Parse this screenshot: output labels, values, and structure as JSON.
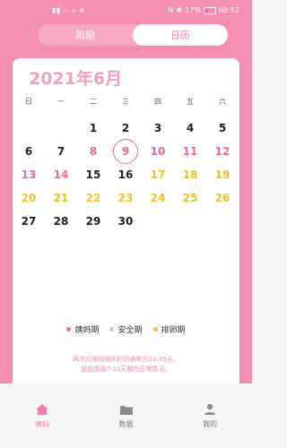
{
  "status_bar": {
    "left": "▮▮ ᵢₗₗ ᵢₗₗ ≋",
    "right_icons": [
      "N",
      "✱"
    ],
    "battery_text": "17%",
    "time": "00:52"
  },
  "segments": {
    "tab1": "周期",
    "tab2": "日历",
    "active": 2
  },
  "calendar": {
    "title": "2021年6月",
    "weekdays": [
      "日",
      "一",
      "二",
      "三",
      "四",
      "五",
      "六"
    ],
    "weeks": [
      [
        {
          "d": ""
        },
        {
          "d": ""
        },
        {
          "d": "1",
          "t": "normal"
        },
        {
          "d": "2",
          "t": "normal"
        },
        {
          "d": "3",
          "t": "normal"
        },
        {
          "d": "4",
          "t": "normal"
        },
        {
          "d": "5",
          "t": "normal"
        }
      ],
      [
        {
          "d": "6",
          "t": "normal"
        },
        {
          "d": "7",
          "t": "normal"
        },
        {
          "d": "8",
          "t": "period"
        },
        {
          "d": "9",
          "t": "period",
          "today": true
        },
        {
          "d": "10",
          "t": "period"
        },
        {
          "d": "11",
          "t": "period"
        },
        {
          "d": "12",
          "t": "period"
        }
      ],
      [
        {
          "d": "13",
          "t": "period"
        },
        {
          "d": "14",
          "t": "period"
        },
        {
          "d": "15",
          "t": "normal"
        },
        {
          "d": "16",
          "t": "normal"
        },
        {
          "d": "17",
          "t": "ovulation"
        },
        {
          "d": "18",
          "t": "ovulation"
        },
        {
          "d": "19",
          "t": "ovulation"
        }
      ],
      [
        {
          "d": "20",
          "t": "ovulation"
        },
        {
          "d": "21",
          "t": "ovulation"
        },
        {
          "d": "22",
          "t": "ovulation"
        },
        {
          "d": "23",
          "t": "ovulation"
        },
        {
          "d": "24",
          "t": "ovulation"
        },
        {
          "d": "25",
          "t": "ovulation"
        },
        {
          "d": "26",
          "t": "ovulation"
        }
      ],
      [
        {
          "d": "27",
          "t": "normal"
        },
        {
          "d": "28",
          "t": "normal"
        },
        {
          "d": "29",
          "t": "normal"
        },
        {
          "d": "30",
          "t": "normal"
        },
        {
          "d": ""
        },
        {
          "d": ""
        },
        {
          "d": ""
        }
      ]
    ]
  },
  "legend": {
    "period": "姨妈期",
    "safe": "安全期",
    "ovulation": "排卵期",
    "colors": {
      "period": "#e86f92",
      "safe": "#c9c9c9",
      "ovulation": "#f4c21f"
    }
  },
  "note": {
    "line1": "两次经期相隔的时间通常为23-35天，",
    "line2": "提前推后7-10天都为正常情况。"
  },
  "tabbar": {
    "home": "姨妈",
    "data": "数据",
    "mine": "我的",
    "active": "home"
  }
}
